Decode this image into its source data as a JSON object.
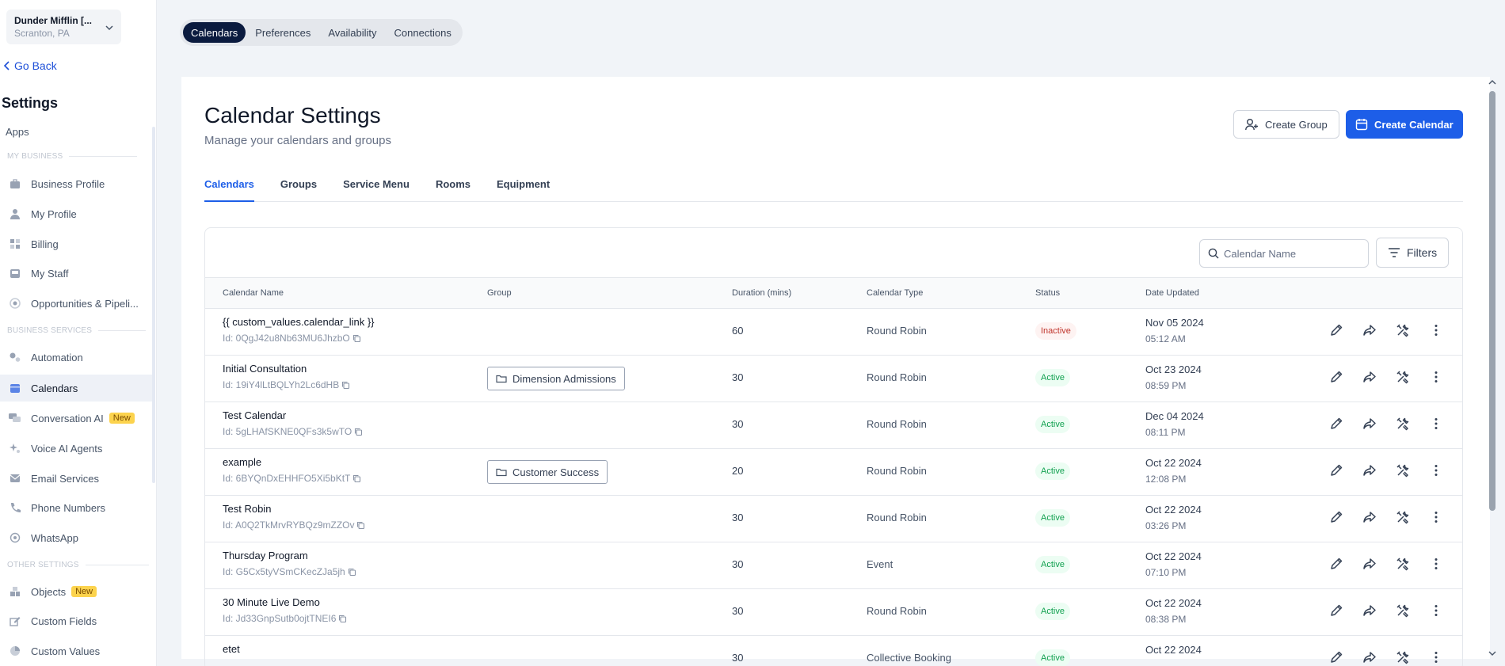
{
  "location": {
    "name": "Dunder Mifflin [...",
    "city": "Scranton, PA"
  },
  "sidebar": {
    "go_back": "Go Back",
    "title": "Settings",
    "apps": "Apps",
    "section_my_business": "MY BUSINESS",
    "section_business_services": "BUSINESS SERVICES",
    "section_other_settings": "OTHER SETTINGS",
    "items": [
      {
        "label": "Business Profile",
        "icon": "briefcase-icon"
      },
      {
        "label": "My Profile",
        "icon": "user-icon"
      },
      {
        "label": "Billing",
        "icon": "grid-icon"
      },
      {
        "label": "My Staff",
        "icon": "inbox-icon"
      },
      {
        "label": "Opportunities & Pipeli...",
        "icon": "target-icon"
      },
      {
        "label": "Automation",
        "icon": "gears-icon"
      },
      {
        "label": "Calendars",
        "icon": "calendar-icon"
      },
      {
        "label": "Conversation AI",
        "icon": "chat-icon",
        "badge": "New"
      },
      {
        "label": "Voice AI Agents",
        "icon": "sparkle-icon"
      },
      {
        "label": "Email Services",
        "icon": "mail-icon"
      },
      {
        "label": "Phone Numbers",
        "icon": "phone-icon"
      },
      {
        "label": "WhatsApp",
        "icon": "whatsapp-icon"
      },
      {
        "label": "Objects",
        "icon": "objects-icon",
        "badge": "New"
      },
      {
        "label": "Custom Fields",
        "icon": "edit-field-icon"
      },
      {
        "label": "Custom Values",
        "icon": "pie-icon"
      }
    ]
  },
  "top_tabs": [
    "Calendars",
    "Preferences",
    "Availability",
    "Connections"
  ],
  "header": {
    "title": "Calendar Settings",
    "subtitle": "Manage your calendars and groups",
    "create_group": "Create Group",
    "create_calendar": "Create Calendar"
  },
  "sub_tabs": [
    "Calendars",
    "Groups",
    "Service Menu",
    "Rooms",
    "Equipment"
  ],
  "search": {
    "placeholder": "Calendar Name"
  },
  "filters_label": "Filters",
  "table": {
    "columns": [
      "Calendar Name",
      "Group",
      "Duration (mins)",
      "Calendar Type",
      "Status",
      "Date Updated"
    ],
    "rows": [
      {
        "name": "{{ custom_values.calendar_link }}",
        "id": "Id: 0QgJ42u8Nb63MU6JhzbO",
        "group": "",
        "duration": "60",
        "type": "Round Robin",
        "status": "Inactive",
        "date": "Nov 05 2024",
        "time": "05:12 AM"
      },
      {
        "name": "Initial Consultation",
        "id": "Id: 19iY4lLtBQLYh2Lc6dHB",
        "group": "Dimension Admissions",
        "duration": "30",
        "type": "Round Robin",
        "status": "Active",
        "date": "Oct 23 2024",
        "time": "08:59 PM"
      },
      {
        "name": "Test Calendar",
        "id": "Id: 5gLHAfSKNE0QFs3k5wTO",
        "group": "",
        "duration": "30",
        "type": "Round Robin",
        "status": "Active",
        "date": "Dec 04 2024",
        "time": "08:11 PM"
      },
      {
        "name": "example",
        "id": "Id: 6BYQnDxEHHFO5Xi5bKtT",
        "group": "Customer Success",
        "duration": "20",
        "type": "Round Robin",
        "status": "Active",
        "date": "Oct 22 2024",
        "time": "12:08 PM"
      },
      {
        "name": "Test Robin",
        "id": "Id: A0Q2TkMrvRYBQz9mZZOv",
        "group": "",
        "duration": "30",
        "type": "Round Robin",
        "status": "Active",
        "date": "Oct 22 2024",
        "time": "03:26 PM"
      },
      {
        "name": "Thursday Program",
        "id": "Id: G5Cx5tyVSmCKecZJa5jh",
        "group": "",
        "duration": "30",
        "type": "Event",
        "status": "Active",
        "date": "Oct 22 2024",
        "time": "07:10 PM"
      },
      {
        "name": "30 Minute Live Demo",
        "id": "Id: Jd33GnpSutb0ojtTNEI6",
        "group": "",
        "duration": "30",
        "type": "Round Robin",
        "status": "Active",
        "date": "Oct 22 2024",
        "time": "08:38 PM"
      },
      {
        "name": "etet",
        "id": "",
        "group": "",
        "duration": "30",
        "type": "Collective Booking",
        "status": "Active",
        "date": "Oct 22 2024",
        "time": ""
      }
    ]
  },
  "colors": {
    "primary": "#1d5ee8",
    "nav_dark": "#0b1b3f",
    "active_green": "#12a150",
    "inactive_red": "#c0342b"
  }
}
